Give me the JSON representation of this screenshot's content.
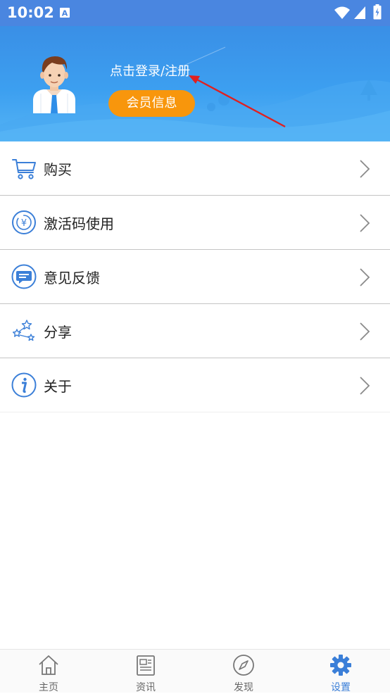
{
  "status_bar": {
    "time": "10:02",
    "notification_icon": "a-icon"
  },
  "header": {
    "login_text": "点击登录/注册",
    "member_button": "会员信息"
  },
  "menu": {
    "items": [
      {
        "label": "购买",
        "icon": "cart-icon"
      },
      {
        "label": "激活码使用",
        "icon": "yen-icon"
      },
      {
        "label": "意见反馈",
        "icon": "feedback-icon"
      },
      {
        "label": "分享",
        "icon": "share-icon"
      },
      {
        "label": "关于",
        "icon": "info-icon"
      }
    ]
  },
  "tabbar": {
    "tabs": [
      {
        "label": "主页",
        "icon": "home-icon"
      },
      {
        "label": "资讯",
        "icon": "news-icon"
      },
      {
        "label": "发现",
        "icon": "compass-icon"
      },
      {
        "label": "设置",
        "icon": "gear-icon",
        "active": true
      }
    ]
  },
  "colors": {
    "header_blue": "#3c9ff0",
    "accent_orange": "#f8960c",
    "icon_blue": "#3b7fd8",
    "annotation_red": "#e02020"
  }
}
